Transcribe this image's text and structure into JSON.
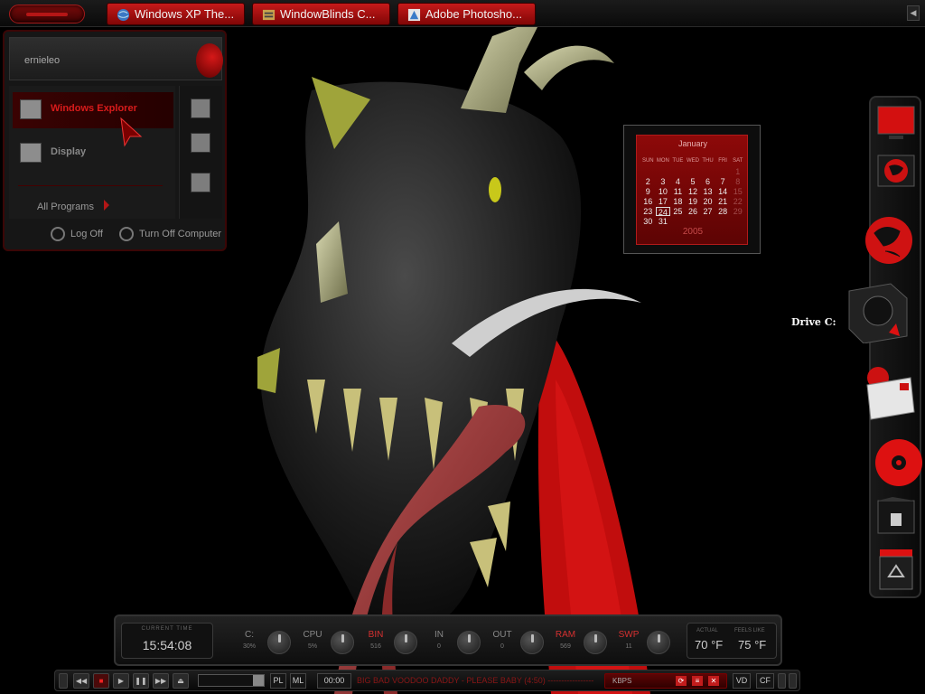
{
  "taskbar": {
    "tasks": [
      {
        "label": "Windows XP The...",
        "icon": "globe-icon"
      },
      {
        "label": "WindowBlinds C...",
        "icon": "windowblinds-icon"
      },
      {
        "label": "Adobe Photosho...",
        "icon": "photoshop-icon"
      }
    ],
    "tray_arrow": "◀"
  },
  "start_menu": {
    "user_name": "ernieleo",
    "items": [
      {
        "label": "Windows Explorer",
        "icon": "explorer-icon",
        "active": true
      },
      {
        "label": "Display",
        "icon": "display-icon",
        "active": false
      }
    ],
    "all_programs": "All Programs",
    "log_off": "Log Off",
    "turn_off": "Turn Off Computer"
  },
  "calendar": {
    "month": "January",
    "year": "2005",
    "weekdays": [
      "SUN",
      "MON",
      "TUE",
      "WED",
      "THU",
      "FRI",
      "SAT"
    ],
    "days": [
      {
        "d": "",
        "m": false
      },
      {
        "d": "",
        "m": false
      },
      {
        "d": "",
        "m": false
      },
      {
        "d": "",
        "m": false
      },
      {
        "d": "",
        "m": false
      },
      {
        "d": "",
        "m": false
      },
      {
        "d": "1",
        "m": true
      },
      {
        "d": "2",
        "m": false
      },
      {
        "d": "3",
        "m": false
      },
      {
        "d": "4",
        "m": false
      },
      {
        "d": "5",
        "m": false
      },
      {
        "d": "6",
        "m": false
      },
      {
        "d": "7",
        "m": false
      },
      {
        "d": "8",
        "m": true
      },
      {
        "d": "9",
        "m": false
      },
      {
        "d": "10",
        "m": false
      },
      {
        "d": "11",
        "m": false
      },
      {
        "d": "12",
        "m": false
      },
      {
        "d": "13",
        "m": false
      },
      {
        "d": "14",
        "m": false
      },
      {
        "d": "15",
        "m": true
      },
      {
        "d": "16",
        "m": false
      },
      {
        "d": "17",
        "m": false
      },
      {
        "d": "18",
        "m": false
      },
      {
        "d": "19",
        "m": false
      },
      {
        "d": "20",
        "m": false
      },
      {
        "d": "21",
        "m": false
      },
      {
        "d": "22",
        "m": true
      },
      {
        "d": "23",
        "m": false
      },
      {
        "d": "24",
        "m": false
      },
      {
        "d": "25",
        "m": false
      },
      {
        "d": "26",
        "m": false
      },
      {
        "d": "27",
        "m": false
      },
      {
        "d": "28",
        "m": false
      },
      {
        "d": "29",
        "m": true
      },
      {
        "d": "30",
        "m": false
      },
      {
        "d": "31",
        "m": false
      }
    ],
    "today": "24"
  },
  "desktop": {
    "drive_label": "Drive C:"
  },
  "meters": {
    "time_head": "CURRENT TIME",
    "time": "15:54:08",
    "gauges": [
      {
        "label": "C:",
        "value": "30%",
        "red": false
      },
      {
        "label": "CPU",
        "value": "5%",
        "red": false
      },
      {
        "label": "BIN",
        "value": "516",
        "red": true
      },
      {
        "label": "IN",
        "value": "0",
        "red": false
      },
      {
        "label": "OUT",
        "value": "0",
        "red": false
      },
      {
        "label": "RAM",
        "value": "569",
        "red": true
      },
      {
        "label": "SWP",
        "value": "11",
        "red": true
      }
    ],
    "actual_head": "ACTUAL",
    "actual_temp": "70 °F",
    "feels_head": "FEELS LIKE",
    "feels_temp": "75 °F"
  },
  "player": {
    "pl": "PL",
    "ml": "ML",
    "time": "00:00",
    "track": "BIG BAD VOODOO DADDY - PLEASE BABY (4:50) -----------------",
    "kbps": "KBPS",
    "vd": "VD",
    "cf": "CF"
  },
  "colors": {
    "accent": "#c41a1a",
    "background": "#000000"
  }
}
